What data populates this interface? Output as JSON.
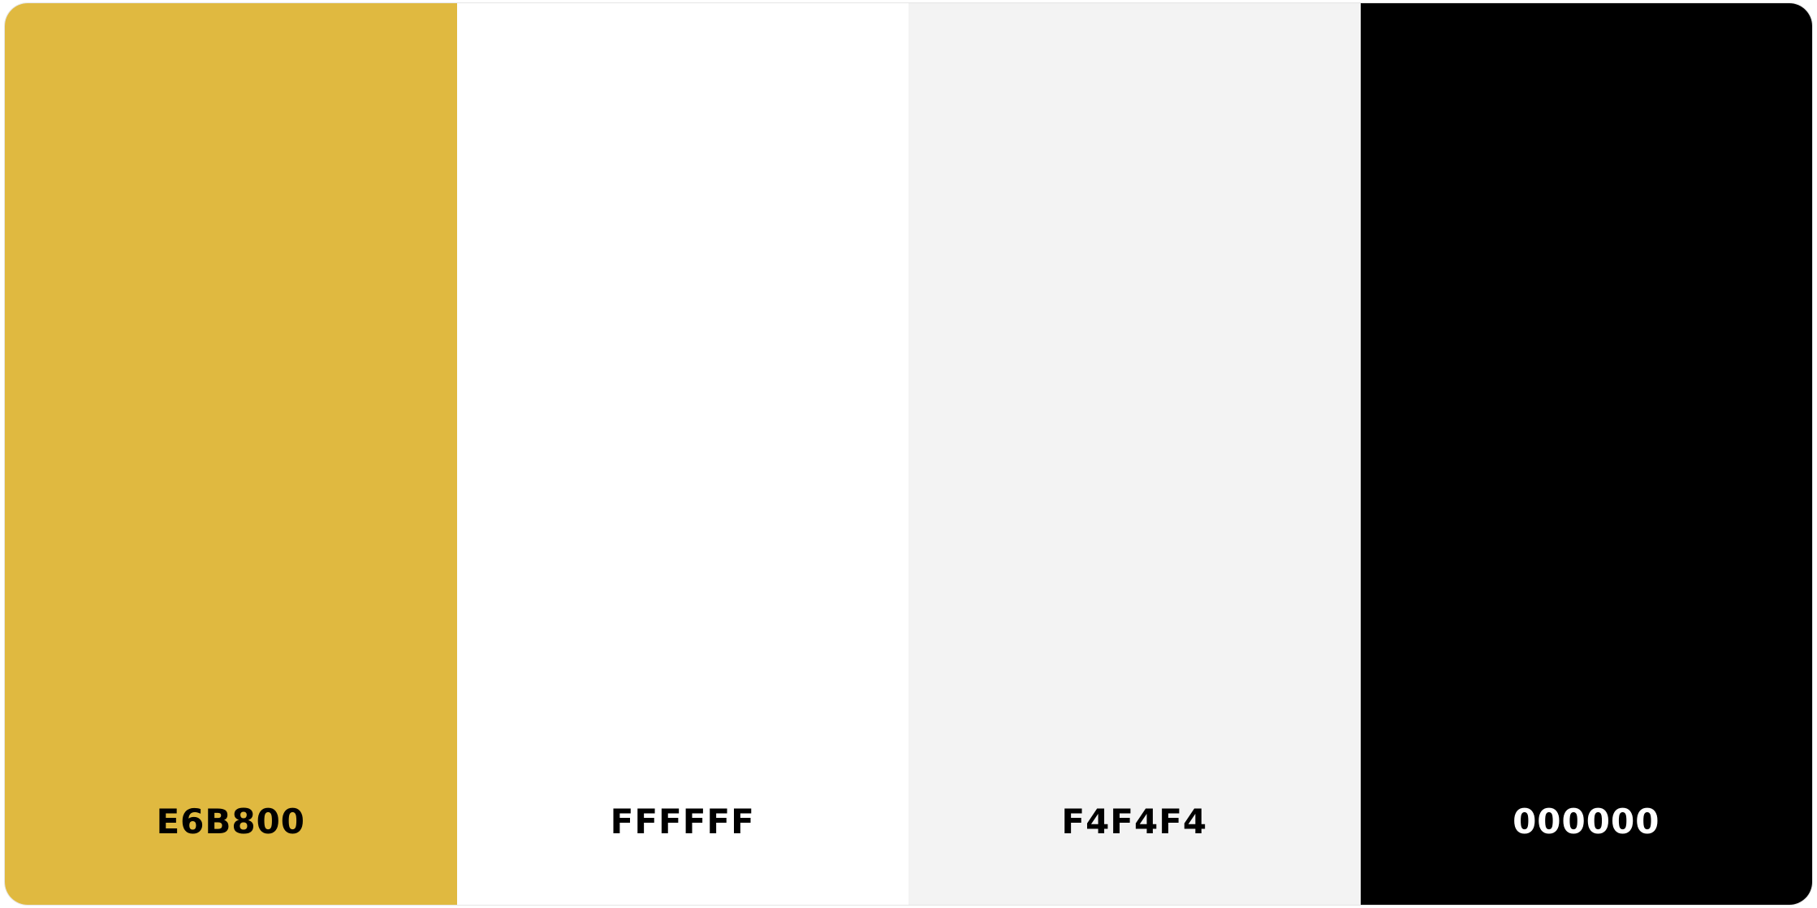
{
  "palette": {
    "swatches": [
      {
        "code": "E6B800",
        "color": "#E0B940",
        "text_color": "#000000"
      },
      {
        "code": "FFFFFF",
        "color": "#FFFFFF",
        "text_color": "#000000"
      },
      {
        "code": "F4F4F4",
        "color": "#F3F3F3",
        "text_color": "#000000"
      },
      {
        "code": "000000",
        "color": "#000000",
        "text_color": "#FFFFFF"
      }
    ]
  }
}
